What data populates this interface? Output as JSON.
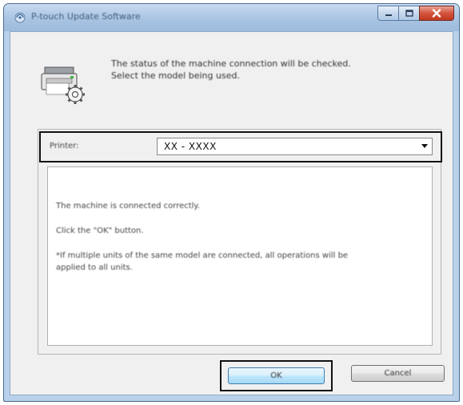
{
  "window": {
    "title": "P-touch Update Software",
    "minimize_icon": "minimize-icon",
    "maximize_icon": "maximize-icon",
    "close_icon": "close-icon",
    "app_icon": "app-icon"
  },
  "header": {
    "icon": "printer-gear-icon",
    "line1": "The status of the machine connection will be checked.",
    "line2": "Select the model being used."
  },
  "printer": {
    "label": "Printer:",
    "selected": "XX - XXXX"
  },
  "message": {
    "line1": "The machine is connected correctly.",
    "line2": "Click the \"OK\" button.",
    "line3": "*If multiple units of the same model are connected, all operations will be",
    "line4": "applied to all units."
  },
  "buttons": {
    "ok": "OK",
    "cancel": "Cancel"
  },
  "colors": {
    "frame": "#b9d1ea",
    "client": "#f0f0f0",
    "close": "#c7452f",
    "highlight_outline": "#111111"
  }
}
